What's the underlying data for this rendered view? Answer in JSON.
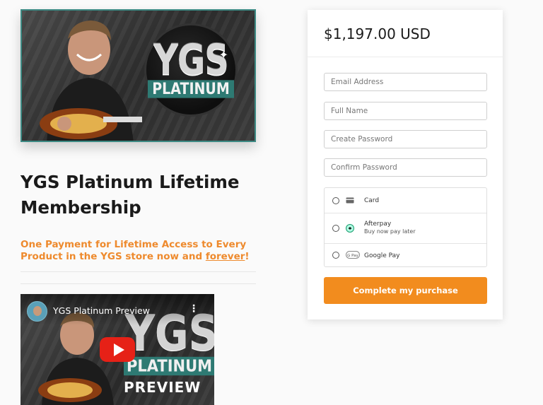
{
  "product": {
    "hero_logo": {
      "main": "YGS",
      "sub": "PLATINUM"
    },
    "title": "YGS Platinum Lifetime Membership",
    "subtitle_prefix": "One Payment for Lifetime Access to Every Product in the YGS store now and ",
    "subtitle_link": "forever",
    "subtitle_suffix": "!"
  },
  "video": {
    "title": "YGS Platinum Preview",
    "menu_glyph": "⋮",
    "thumb_main": "YGS",
    "thumb_sub": "PLATINUM",
    "thumb_caption": "PREVIEW"
  },
  "checkout": {
    "price": "$1,197.00 USD",
    "fields": {
      "email_placeholder": "Email Address",
      "name_placeholder": "Full Name",
      "password_placeholder": "Create Password",
      "confirm_placeholder": "Confirm Password"
    },
    "payment_methods": [
      {
        "label": "Card",
        "sublabel": "",
        "icon": "credit-card-icon"
      },
      {
        "label": "Afterpay",
        "sublabel": "Buy now pay later",
        "icon": "afterpay-icon"
      },
      {
        "label": "Google Pay",
        "sublabel": "",
        "icon": "google-pay-icon"
      }
    ],
    "submit_label": "Complete my purchase"
  },
  "colors": {
    "accent": "#f28c1e",
    "subtitle": "#ee8a2d",
    "teal": "#2e7a73",
    "youtube_red": "#e62117"
  }
}
